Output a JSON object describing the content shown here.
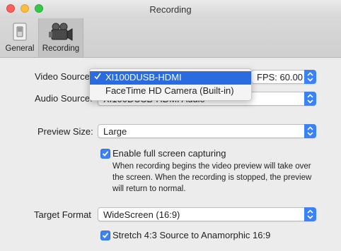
{
  "window": {
    "title": "Recording"
  },
  "toolbar": {
    "items": [
      {
        "label": "General",
        "icon": "switch-icon"
      },
      {
        "label": "Recording",
        "icon": "camera-icon"
      }
    ]
  },
  "form": {
    "video_source_label": "Video Source",
    "video_source_value": "XI100DUSB-HDMI",
    "video_source_options": [
      "XI100DUSB-HDMI",
      "FaceTime HD Camera (Built-in)"
    ],
    "fps_value": "FPS: 60.00",
    "audio_source_label": "Audio Source:",
    "audio_source_value": "XI100DUSB-HDMI Audio",
    "preview_size_label": "Preview Size:",
    "preview_size_value": "Large",
    "fullscreen_checkbox_label": "Enable full screen capturing",
    "fullscreen_checked": true,
    "fullscreen_desc": "When recording begins the video preview will take over the screen. When the recording is stopped, the preview will return to normal.",
    "target_format_label": "Target Format",
    "target_format_value": "WideScreen (16:9)",
    "stretch_checkbox_label": "Stretch 4:3 Source to Anamorphic 16:9",
    "stretch_checked": true
  },
  "colors": {
    "accent": "#3b82f7",
    "selection": "#2a6cdf"
  }
}
